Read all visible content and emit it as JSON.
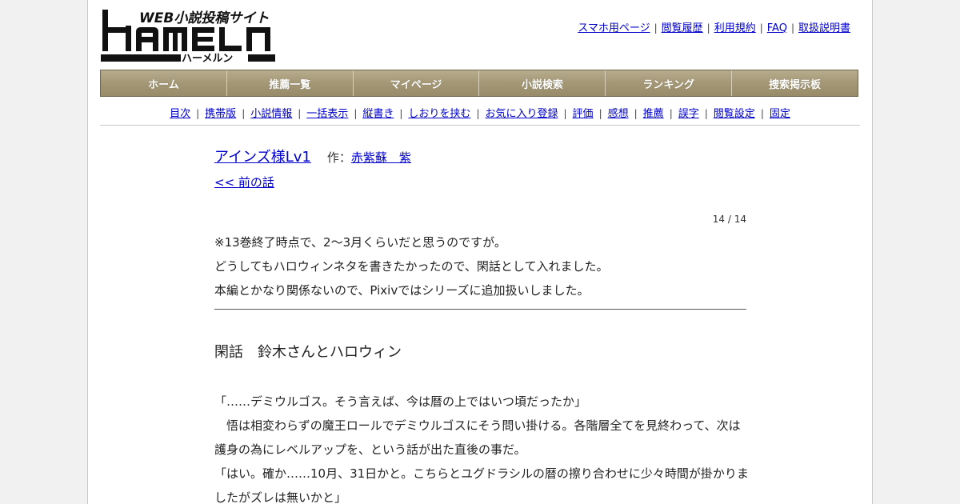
{
  "logo": {
    "tagline": "WEB小説投稿サイト",
    "wordmark": "HAMELN",
    "reading": "ハーメルン"
  },
  "top_links": [
    "スマホ用ページ",
    "閲覧履歴",
    "利用規約",
    "FAQ",
    "取扱説明書"
  ],
  "main_nav": [
    "ホーム",
    "推薦一覧",
    "マイページ",
    "小説検索",
    "ランキング",
    "捜索掲示板"
  ],
  "sub_nav": [
    "目次",
    "携帯版",
    "小説情報",
    "一括表示",
    "縦書き",
    "しおりを挟む",
    "お気に入り登録",
    "評価",
    "感想",
    "推薦",
    "誤字",
    "閲覧設定",
    "固定"
  ],
  "novel": {
    "title": "アインズ様Lv1",
    "author_prefix": "作：",
    "author": "赤紫蘇　紫",
    "prev_link": "<< 前の話",
    "page_count": "14 / 14"
  },
  "preface_lines": [
    "※13巻終了時点で、2～3月くらいだと思うのですが。",
    "どうしてもハロウィンネタを書きたかったので、閑話として入れました。",
    "本編とかなり関係ないので、Pixivではシリーズに追加扱いしました。"
  ],
  "chapter_title": "閑話　鈴木さんとハロウィン",
  "body_lines": [
    "「……デミウルゴス。そう言えば、今は暦の上ではいつ頃だったか」",
    "　悟は相変わらずの魔王ロールでデミウルゴスにそう問い掛ける。各階層全てを見終わって、次は",
    "護身の為にレベルアップを、という話が出た直後の事だ。",
    "「はい。確か……10月、31日かと。こちらとユグドラシルの暦の擦り合わせに少々時間が掛かりま",
    "したがズレは無いかと」"
  ],
  "colors": {
    "nav_gradient_top": "#b7ac8c",
    "nav_gradient_bottom": "#978b6a",
    "link": "#0000cc",
    "page_bg": "#f1f1f1"
  }
}
